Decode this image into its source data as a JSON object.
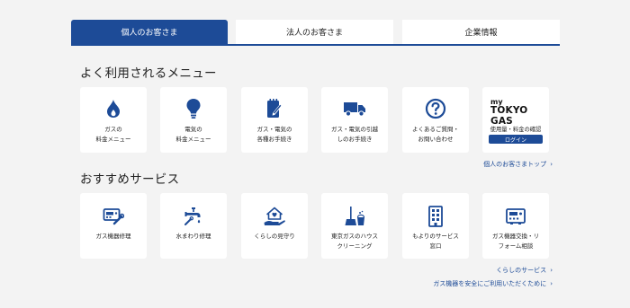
{
  "tabs": [
    {
      "label": "個人のお客さま",
      "active": true
    },
    {
      "label": "法人のお客さま",
      "active": false
    },
    {
      "label": "企業情報",
      "active": false
    }
  ],
  "menu_section": {
    "title": "よく利用されるメニュー",
    "items": [
      {
        "label": "ガスの\n料金メニュー",
        "icon": "gas-flame-icon"
      },
      {
        "label": "電気の\n料金メニュー",
        "icon": "light-bulb-icon"
      },
      {
        "label": "ガス・電気の\n各種お手続き",
        "icon": "notepad-pencil-icon"
      },
      {
        "label": "ガス・電気の引越\nしのお手続き",
        "icon": "moving-truck-icon"
      },
      {
        "label": "よくあるご質問・\nお問い合わせ",
        "icon": "question-circle-icon"
      }
    ],
    "tokyogas": {
      "my": "my",
      "name": "TOKYO GAS",
      "sub": "使用量・料金の確認",
      "login": "ログイン"
    },
    "link": "個人のお客さまトップ"
  },
  "service_section": {
    "title": "おすすめサービス",
    "items": [
      {
        "label": "ガス機器修理",
        "icon": "appliance-repair-icon"
      },
      {
        "label": "水まわり修理",
        "icon": "faucet-repair-icon"
      },
      {
        "label": "くらしの見守り",
        "icon": "home-care-icon"
      },
      {
        "label": "東京ガスのハウス\nクリーニング",
        "icon": "cleaning-icon"
      },
      {
        "label": "もよりのサービス\n窓口",
        "icon": "building-icon"
      },
      {
        "label": "ガス機器交換・リ\nフォーム相談",
        "icon": "appliance-exchange-icon"
      }
    ],
    "links": [
      "くらしのサービス",
      "ガス機器を安全にご利用いただくために"
    ]
  },
  "colors": {
    "brand": "#1d4b97",
    "background": "#f3f3f3"
  }
}
